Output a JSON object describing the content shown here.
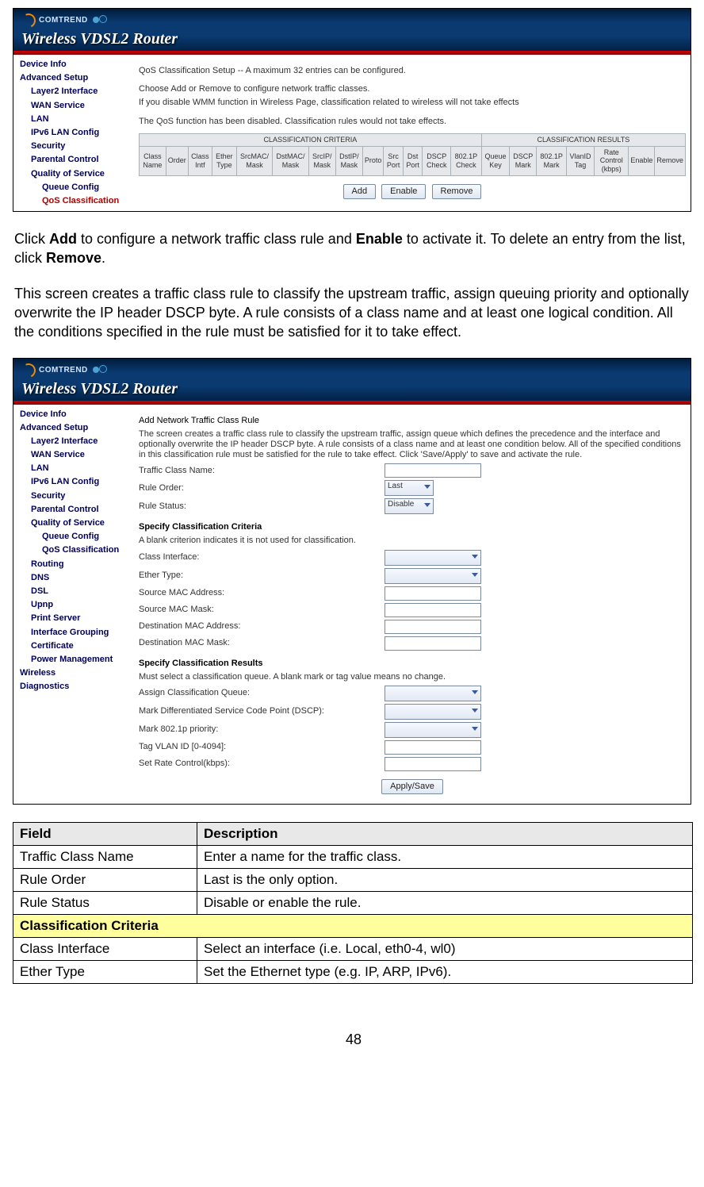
{
  "brand": "COMTREND",
  "product": "Wireless VDSL2 Router",
  "shot1": {
    "heading": "QoS Classification Setup -- A maximum 32 entries can be configured.",
    "line1": "Choose Add or Remove to configure network traffic classes.",
    "line2": "If you disable WMM function in Wireless Page, classification related to wireless will not take effects",
    "line3": "The QoS function has been disabled. Classification rules would not take effects.",
    "group1": "CLASSIFICATION CRITERIA",
    "group2": "CLASSIFICATION RESULTS",
    "cols": [
      "Class Name",
      "Order",
      "Class Intf",
      "Ether Type",
      "SrcMAC/ Mask",
      "DstMAC/ Mask",
      "SrcIP/ Mask",
      "DstIP/ Mask",
      "Proto",
      "Src Port",
      "Dst Port",
      "DSCP Check",
      "802.1P Check",
      "Queue Key",
      "DSCP Mark",
      "802.1P Mark",
      "VlanID Tag",
      "Rate Control (kbps)",
      "Enable",
      "Remove"
    ],
    "btn_add": "Add",
    "btn_enable": "Enable",
    "btn_remove": "Remove",
    "nav": [
      "Device Info",
      "Advanced Setup",
      "Layer2 Interface",
      "WAN Service",
      "LAN",
      "IPv6 LAN Config",
      "Security",
      "Parental Control",
      "Quality of Service",
      "Queue Config",
      "QoS Classification"
    ]
  },
  "instr1": {
    "p1a": "Click ",
    "p1b": "Add",
    "p1c": " to configure a network traffic class rule and ",
    "p1d": "Enable",
    "p1e": " to activate it. To delete an entry from the list, click ",
    "p1f": "Remove",
    "p1g": ".",
    "p2": "This screen creates a traffic class rule to classify the upstream traffic, assign queuing priority and optionally overwrite the IP header DSCP byte. A rule consists of a class name and at least one logical condition. All the conditions specified in the rule must be satisfied for it to take effect."
  },
  "shot2": {
    "heading": "Add Network Traffic Class Rule",
    "intro": "The screen creates a traffic class rule to classify the upstream traffic, assign queue which defines the precedence and the interface and optionally overwrite the IP header DSCP byte. A rule consists of a class name and at least one condition below. All of the specified conditions in this classification rule must be satisfied for the rule to take effect. Click 'Save/Apply' to save and activate the rule.",
    "f_tcn": "Traffic Class Name:",
    "f_ro": "Rule Order:",
    "v_ro": "Last",
    "f_rs": "Rule Status:",
    "v_rs": "Disable",
    "sec1": "Specify Classification Criteria",
    "sec1sub": "A blank criterion indicates it is not used for classification.",
    "f_ci": "Class Interface:",
    "f_et": "Ether Type:",
    "f_smac": "Source MAC Address:",
    "f_smask": "Source MAC Mask:",
    "f_dmac": "Destination MAC Address:",
    "f_dmask": "Destination MAC Mask:",
    "sec2": "Specify Classification Results",
    "sec2sub": "Must select a classification queue. A blank mark or tag value means no change.",
    "f_acq": "Assign Classification Queue:",
    "f_dscp": "Mark Differentiated Service Code Point (DSCP):",
    "f_8021p": "Mark 802.1p priority:",
    "f_vlan": "Tag VLAN ID [0-4094]:",
    "f_rate": "Set Rate Control(kbps):",
    "btn": "Apply/Save",
    "nav": [
      "Device Info",
      "Advanced Setup",
      "Layer2 Interface",
      "WAN Service",
      "LAN",
      "IPv6 LAN Config",
      "Security",
      "Parental Control",
      "Quality of Service",
      "Queue Config",
      "QoS Classification",
      "Routing",
      "DNS",
      "DSL",
      "Upnp",
      "Print Server",
      "Interface Grouping",
      "Certificate",
      "Power Management",
      "Wireless",
      "Diagnostics"
    ]
  },
  "table": {
    "h1": "Field",
    "h2": "Description",
    "rows": [
      {
        "f": "Traffic Class Name",
        "d": "Enter a name for the traffic class."
      },
      {
        "f": "Rule Order",
        "d": "Last is the only option."
      },
      {
        "f": "Rule Status",
        "d": "Disable or enable the rule."
      }
    ],
    "section": "Classification Criteria",
    "rows2": [
      {
        "f": "Class Interface",
        "d": "Select an interface (i.e. Local, eth0-4, wl0)"
      },
      {
        "f": "Ether Type",
        "d": "Set the Ethernet type (e.g. IP, ARP, IPv6)."
      }
    ]
  },
  "pagenum": "48"
}
